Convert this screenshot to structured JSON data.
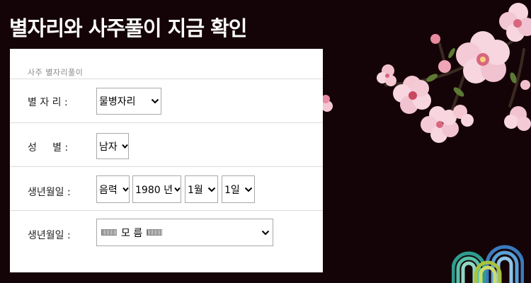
{
  "headline": "별자리와 사주풀이 지금 확인",
  "panel": {
    "caption": "사주 별자리풀이",
    "rows": {
      "zodiac": {
        "label": "별 자 리 :",
        "value": "물병자리"
      },
      "gender": {
        "label": "성     별 :",
        "value": "남자"
      },
      "birth": {
        "label": "생년월일 :",
        "calendar": "음력",
        "year": "1980 년",
        "month": "1월",
        "day": "1일"
      },
      "birth_time": {
        "label": "생년월일 :",
        "value": "모 름"
      }
    }
  },
  "colors": {
    "background": "#150407",
    "panel": "#ffffff",
    "blossom": "#f2c4d2",
    "blossom_center": "#d9667f"
  },
  "icons": {
    "decoration": "cherry-blossom-branch",
    "logo": "rainbow-arches-logo"
  }
}
